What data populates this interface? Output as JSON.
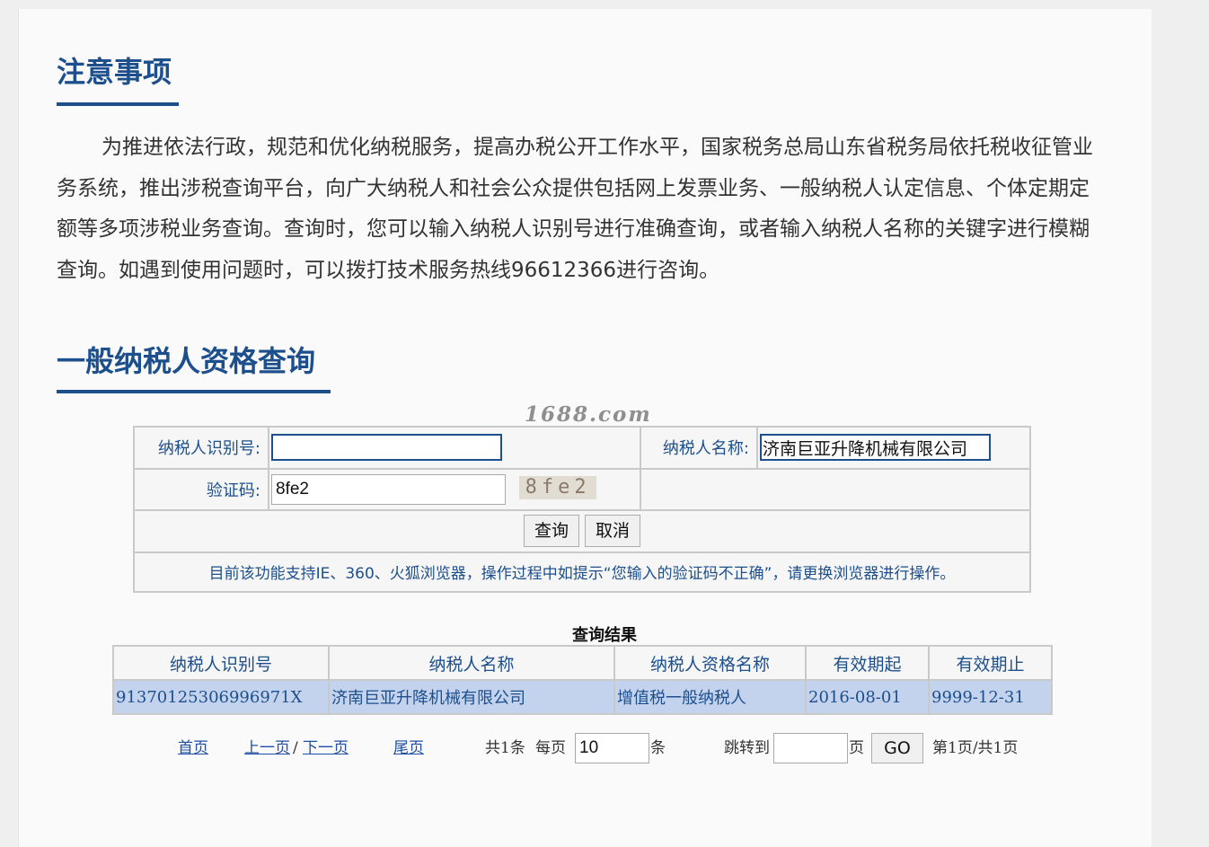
{
  "notice": {
    "title": "注意事项",
    "body": "为推进依法行政，规范和优化纳税服务，提高办税公开工作水平，国家税务总局山东省税务局依托税收征管业务系统，推出涉税查询平台，向广大纳税人和社会公众提供包括网上发票业务、一般纳税人认定信息、个体定期定额等多项涉税业务查询。查询时，您可以输入纳税人识别号进行准确查询，或者输入纳税人名称的关键字进行模糊查询。如遇到使用问题时，可以拨打技术服务热线96612366进行咨询。"
  },
  "query": {
    "title": "一般纳税人资格查询",
    "watermark": "1688.com",
    "taxpayer_id_label": "纳税人识别号:",
    "taxpayer_id_value": "",
    "taxpayer_name_label": "纳税人名称:",
    "taxpayer_name_value": "济南巨亚升降机械有限公司",
    "captcha_label": "验证码:",
    "captcha_value": "8fe2",
    "captcha_image_text": "8fe2",
    "query_button": "查询",
    "cancel_button": "取消",
    "hint": "目前该功能支持IE、360、火狐浏览器，操作过程中如提示“您输入的验证码不正确”，请更换浏览器进行操作。"
  },
  "results": {
    "title": "查询结果",
    "columns": [
      "纳税人识别号",
      "纳税人名称",
      "纳税人资格名称",
      "有效期起",
      "有效期止"
    ],
    "rows": [
      [
        "91370125306996971X",
        "济南巨亚升降机械有限公司",
        "增值税一般纳税人",
        "2016-08-01",
        "9999-12-31"
      ]
    ]
  },
  "pager": {
    "first": "首页",
    "prev": "上一页",
    "separator": "/",
    "next": "下一页",
    "last": "尾页",
    "total": "共1条",
    "per_page_label": "每页",
    "per_page_value": "10",
    "per_page_unit": "条",
    "jump_label": "跳转到",
    "jump_value": "",
    "page_unit": "页",
    "go_button": "GO",
    "status": "第1页/共1页"
  },
  "colors": {
    "accent": "#1d4f8c",
    "row_highlight": "#c3d3ee",
    "link": "#1f4fa2"
  }
}
